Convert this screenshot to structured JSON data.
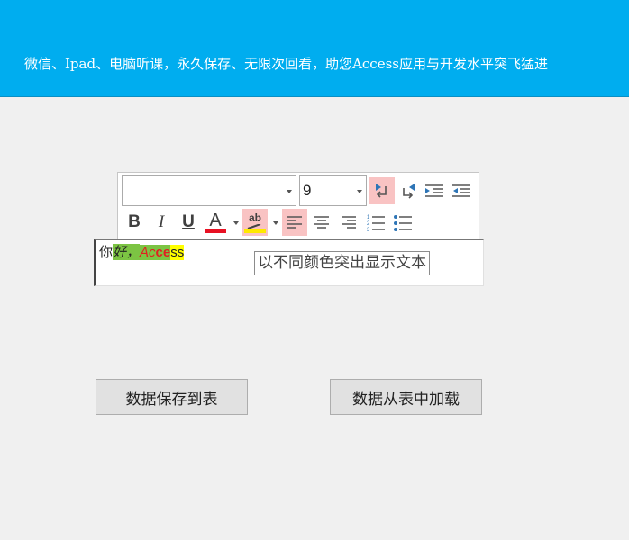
{
  "banner": {
    "text": "微信、Ipad、电脑听课，永久保存、无限次回看，助您Access应用与开发水平突飞猛进",
    "color": "#00adef"
  },
  "toolbar": {
    "font_name": "",
    "font_size": "9",
    "buttons": {
      "bold": "B",
      "italic": "I",
      "underline": "U",
      "font_color": "A",
      "highlight": "ab"
    },
    "font_color_swatch": "#e81123",
    "highlight_swatch": "#ffe800",
    "active_color": "#f9c3c3"
  },
  "editor": {
    "seg_ni": "你",
    "seg_hao": "好，",
    "seg_ac": "Ac",
    "seg_ce": "ce",
    "seg_ss": "ss"
  },
  "tooltip": {
    "text": "以不同颜色突出显示文本"
  },
  "actions": {
    "save_label": "数据保存到表",
    "load_label": "数据从表中加载"
  }
}
